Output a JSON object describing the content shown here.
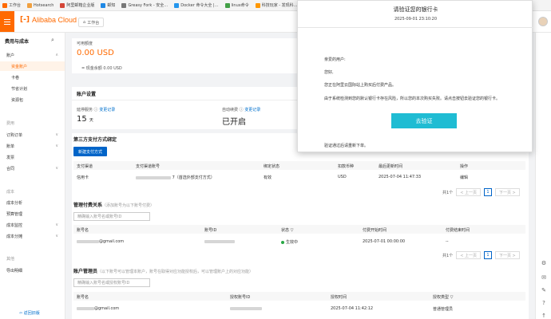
{
  "bookmarks": [
    {
      "label": "工作台",
      "color": "#ff6a00"
    },
    {
      "label": "Hotsearch",
      "color": "#f0a040"
    },
    {
      "label": "阿里邮箱企业版",
      "color": "#d44638"
    },
    {
      "label": "邮知",
      "color": "#1e88e5"
    },
    {
      "label": "Greasy Fork - 安全…",
      "color": "#777777"
    },
    {
      "label": "Docker 命令大全 |…",
      "color": "#2496ed"
    },
    {
      "label": "linux命令",
      "color": "#43a047"
    },
    {
      "label": "科技玩家 - 发现科…",
      "color": "#ff9800"
    }
  ],
  "topnav": {
    "logo_mark": "[-]",
    "logo_text": "Alibaba Cloud",
    "workbench_label": "工作台",
    "home_icon": "home-icon"
  },
  "sidebar": {
    "title": "费用与成本",
    "search_icon": "search-icon",
    "account_label": "账户",
    "items_account": [
      "资金账户",
      "卡卷",
      "节省计划",
      "资源包"
    ],
    "group_fee": "费用",
    "items_fee": [
      {
        "label": "订购订单",
        "chevron": "∨"
      },
      {
        "label": "账单",
        "chevron": "∨"
      },
      {
        "label": "发票",
        "chevron": ""
      },
      {
        "label": "合同",
        "chevron": "∨"
      }
    ],
    "group_cost": "成本",
    "items_cost": [
      {
        "label": "成本分析",
        "chevron": ""
      },
      {
        "label": "预算管理",
        "chevron": ""
      },
      {
        "label": "成本监控",
        "chevron": "∨"
      },
      {
        "label": "成本分摊",
        "chevron": "∨"
      }
    ],
    "group_other": "其他",
    "items_other": [
      "导出明细"
    ],
    "back_link": "返回旧版"
  },
  "account": {
    "available_label": "可用额度",
    "available_value": "0.00 USD",
    "cash_balance": "= 现金余额 0.00 USD"
  },
  "settings": {
    "title": "账户设置",
    "extend_label": "延停服务",
    "extend_link": "变更记录",
    "extend_value": "15",
    "extend_unit": "天",
    "autorenew_label": "自动续费",
    "autorenew_link": "变更记录",
    "autorenew_value": "已开启"
  },
  "payment": {
    "title": "第三方支付方式绑定",
    "new_button": "新建支付方式",
    "headers": [
      "支付渠道",
      "支付渠道账号",
      "绑定状态",
      "扣款币种",
      "最后更新时间",
      "操作"
    ],
    "row": {
      "channel": "信用卡",
      "account_suffix": "7（首选外部支付方式）",
      "status": "有效",
      "currency": "USD",
      "updated": "2025-07-04 11:47:33",
      "action": "编辑"
    },
    "pager": {
      "total": "共1个",
      "prev": "< 上一页",
      "page": "1",
      "next": "下一页 >"
    }
  },
  "paid_relation": {
    "title": "管理付费关系",
    "hint": "（添加账号为以下账号付费）",
    "search_placeholder": "精确输入账号名或账号ID",
    "headers": [
      "账号名",
      "账号ID",
      "状态",
      "付费开始时间",
      "付费结束时间"
    ],
    "row": {
      "name_suffix": "@gmail.com",
      "status": "生效中",
      "start": "2025-07-01 00:00:00",
      "end": "--"
    },
    "pager": {
      "total": "共1个",
      "prev": "< 上一页",
      "page": "1",
      "next": "下一页 >"
    }
  },
  "account_manager": {
    "title": "账户管理员",
    "hint": "（以下账号可以管理本账户，账号在取得对应功能授权后，可以管理账户上的对应功能）",
    "search_placeholder": "精确输入账号名或授权账号ID",
    "headers": [
      "账号名",
      "授权账号ID",
      "授权时间",
      "授权类型"
    ],
    "row": {
      "name_suffix": "@gmail.com",
      "time": "2025-07-04 11:42:12",
      "type": "普通管理员"
    }
  },
  "modal": {
    "title": "请验证您的银行卡",
    "date": "2025-09-01 23:10:20",
    "greeting": "亲爱的用户:",
    "hello": "您好,",
    "line1": "您正在阿里云国际站上购买后付费产品。",
    "line2": "由于系统检测到您的默认银行卡存在风险，所以您的本次购买失败。请点击按钮去验证您的银行卡。",
    "button": "去验证",
    "footer": "验证通过后请重新下单。"
  },
  "rail_icons": [
    "settings-icon",
    "message-icon",
    "feedback-icon",
    "help-icon",
    "top-icon"
  ],
  "colors": {
    "brand": "#ff6a00",
    "primary": "#0064c8",
    "verify": "#1fbcd3"
  }
}
